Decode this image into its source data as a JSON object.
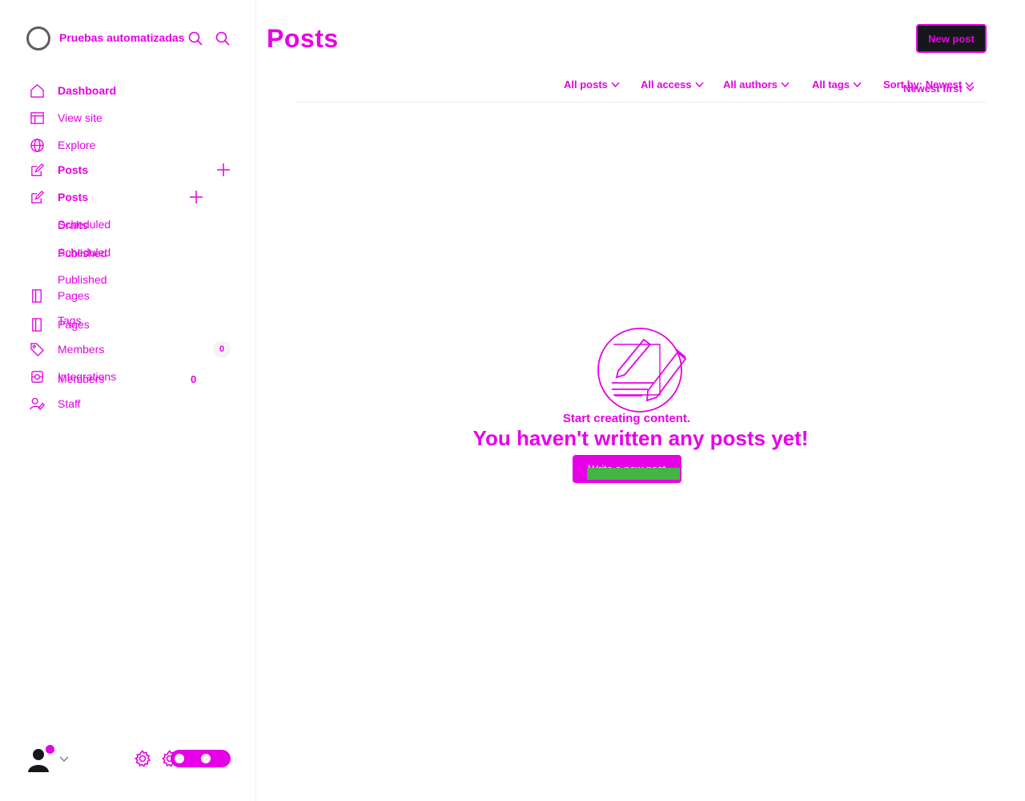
{
  "app": {
    "site_name": "Pruebas automatizadas",
    "page_title": "Posts"
  },
  "sidebar": {
    "items": [
      {
        "label": "Dashboard",
        "icon": "home-icon"
      },
      {
        "label": "View site",
        "icon": "layout-icon"
      },
      {
        "label": "Explore",
        "icon": "globe-icon"
      },
      {
        "label": "Posts",
        "icon": "edit-icon"
      },
      {
        "label": "Posts",
        "icon": "edit-icon"
      },
      {
        "label": "Pages",
        "icon": "page-icon"
      },
      {
        "label": "Pages",
        "icon": "page-icon"
      },
      {
        "label": "Tags",
        "icon": "tag-icon"
      },
      {
        "label": "Members",
        "icon": "members-icon",
        "count": "0"
      },
      {
        "label": "Integrations",
        "icon": "integrations-icon"
      },
      {
        "label": "Members",
        "icon": "members-icon",
        "count": "0"
      },
      {
        "label": "Staff",
        "icon": "staff-icon"
      }
    ],
    "post_subitems": [
      "Drafts",
      "Scheduled",
      "Scheduled",
      "Published",
      "Published"
    ]
  },
  "header": {
    "new_post_label": "New post"
  },
  "filters": {
    "posts": "All posts",
    "access": "All access",
    "authors": "All authors",
    "tags": "All tags",
    "sort": "Sort by: Newest",
    "sort_alt": "Newest first"
  },
  "empty_state": {
    "kicker": "Start creating content.",
    "heading": "You haven't written any posts yet!",
    "button_label": "Write a new post"
  },
  "colors": {
    "accent": "#e600e6",
    "button_dark": "#15171a",
    "green": "#43b543"
  }
}
